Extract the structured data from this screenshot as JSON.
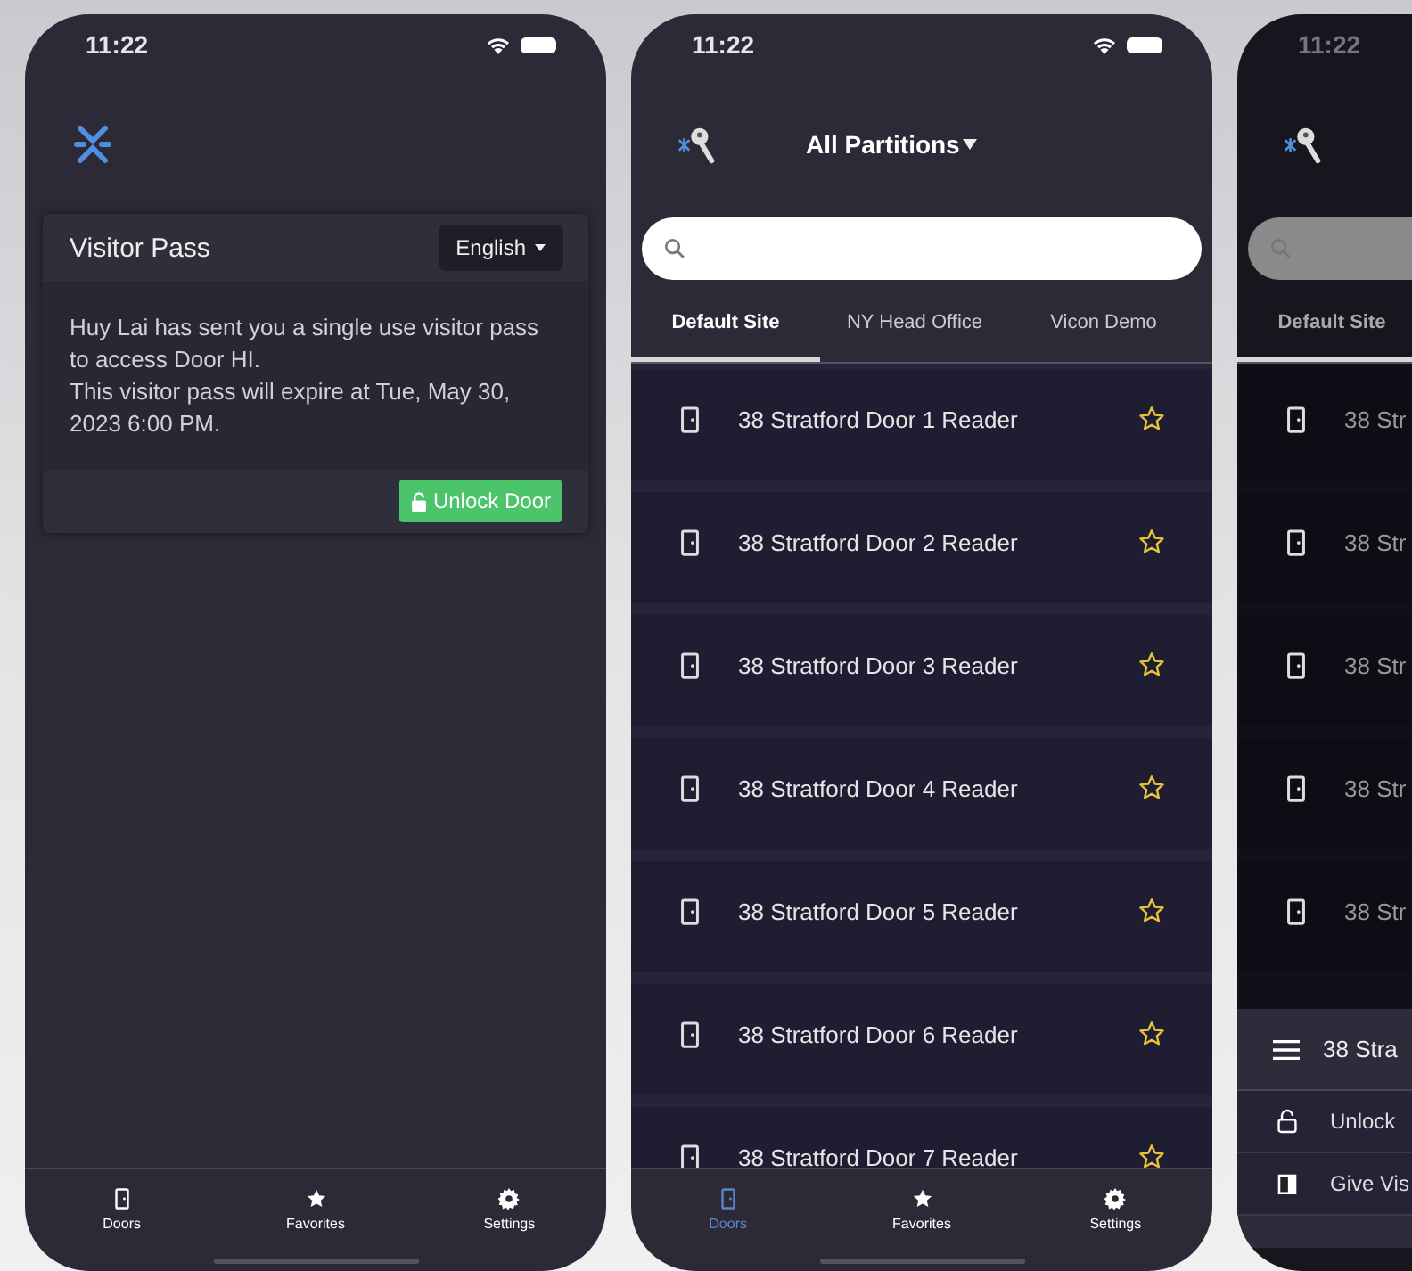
{
  "screens": [
    {
      "kind": "visitor",
      "time": "11:22",
      "card": {
        "title": "Visitor Pass",
        "language": "English",
        "message": [
          "Huy Lai has sent you a single use visitor pass to access Door HI.",
          "This visitor pass will expire at Tue, May 30, 2023 6:00 PM."
        ],
        "button": "Unlock Door"
      },
      "nav": [
        {
          "kind": "doors",
          "label": "Doors",
          "selected": false
        },
        {
          "kind": "favorites",
          "label": "Favorites",
          "selected": false
        },
        {
          "kind": "settings",
          "label": "Settings",
          "selected": false
        }
      ]
    },
    {
      "kind": "doors",
      "time": "11:22",
      "partition": "All Partitions",
      "tabs": [
        {
          "label": "Default Site",
          "selected": true
        },
        {
          "label": "NY Head Office",
          "selected": false
        },
        {
          "label": "Vicon Demo",
          "selected": false
        }
      ],
      "doors": [
        {
          "name": "38 Stratford Door 1 Reader",
          "favorite": false
        },
        {
          "name": "38 Stratford Door 2 Reader",
          "favorite": false
        },
        {
          "name": "38 Stratford Door 3 Reader",
          "favorite": false
        },
        {
          "name": "38 Stratford Door 4 Reader",
          "favorite": false
        },
        {
          "name": "38 Stratford Door 5 Reader",
          "favorite": false
        },
        {
          "name": "38 Stratford Door 6 Reader",
          "favorite": false
        },
        {
          "name": "38 Stratford Door 7 Reader",
          "favorite": false
        }
      ],
      "nav": [
        {
          "kind": "doors",
          "label": "Doors",
          "selected": true
        },
        {
          "kind": "favorites",
          "label": "Favorites",
          "selected": false
        },
        {
          "kind": "settings",
          "label": "Settings",
          "selected": false
        }
      ]
    },
    {
      "kind": "door_menu",
      "time": "11:22",
      "tabs": [
        {
          "label": "Default Site",
          "selected": true
        }
      ],
      "doors": [
        {
          "name": "38 Str"
        },
        {
          "name": "38 Str"
        },
        {
          "name": "38 Str"
        },
        {
          "name": "38 Str"
        },
        {
          "name": "38 Str"
        }
      ],
      "sheet": {
        "title": "38 Stra",
        "actions": [
          {
            "kind": "unlock",
            "label": "Unlock"
          },
          {
            "kind": "visitor",
            "label": "Give Vis"
          }
        ]
      }
    }
  ]
}
